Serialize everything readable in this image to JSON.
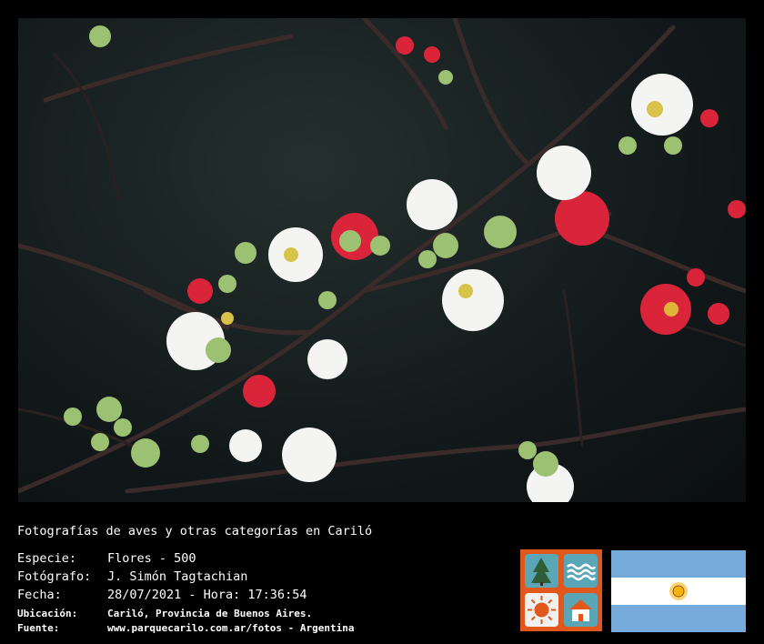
{
  "title": "Fotografías de aves y otras categorías en Cariló",
  "fields": {
    "species_label": "Especie:",
    "species_value": "Flores - 500",
    "photographer_label": "Fotógrafo:",
    "photographer_value": "J. Simón Tagtachian",
    "date_label": "Fecha:",
    "date_value": "28/07/2021 - Hora: 17:36:54",
    "location_label": "Ubicación:",
    "location_value": "Cariló, Provincia de Buenos Aires.",
    "source_label": "Fuente:",
    "source_value": "www.parquecarilo.com.ar/fotos - Argentina"
  },
  "colors": {
    "background": "#000000",
    "logo_orange": "#e2571c",
    "logo_tile": "#5aa6b6",
    "flag_blue": "#75aadb",
    "flag_white": "#ffffff",
    "sun": "#f6b40e"
  },
  "icons": [
    "pine-trees-icon",
    "waves-icon",
    "sun-icon",
    "house-icon",
    "argentina-flag"
  ]
}
